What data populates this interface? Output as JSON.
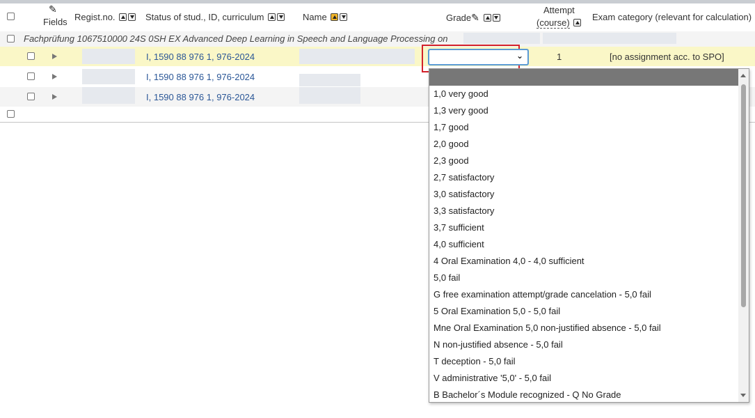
{
  "header": {
    "fields_label": "Fields",
    "regno_label": "Regist.no.",
    "status_label": "Status of stud., ID, curriculum",
    "name_label": "Name",
    "grade_label": "Grade",
    "attempt_label_line1": "Attempt",
    "attempt_label_line2": "(course)",
    "examcat_label": "Exam category (relevant for calculation)"
  },
  "group": {
    "title": "Fachprüfung 1067510000 24S 0SH EX Advanced Deep Learning in Speech and Language Processing on"
  },
  "rows": [
    {
      "status": "I, 1590 88 976 1, 976-2024",
      "attempt": "1",
      "exam_category": "[no assignment acc. to SPO]"
    },
    {
      "status": "I, 1590 88 976 1, 976-2024"
    },
    {
      "status": "I, 1590 88 976 1, 976-2024"
    }
  ],
  "grade_options": [
    "1,0 very good",
    "1,3 very good",
    "1,7 good",
    "2,0 good",
    "2,3 good",
    "2,7 satisfactory",
    "3,0 satisfactory",
    "3,3 satisfactory",
    "3,7 sufficient",
    "4,0 sufficient",
    "4 Oral Examination 4,0 - 4,0 sufficient",
    "5,0 fail",
    "G free examination attempt/grade cancelation - 5,0 fail",
    "5 Oral Examination 5,0 - 5,0 fail",
    "Mne Oral Examination 5,0 non-justified absence - 5,0 fail",
    "N non-justified absence - 5,0 fail",
    "T deception - 5,0 fail",
    "V administrative '5,0' - 5,0 fail",
    "B Bachelor´s Module recognized - Q No Grade"
  ],
  "colors": {
    "link": "#2b5797",
    "selected_row": "#faf7c7",
    "highlight_border": "#d3202a",
    "sort_active": "#f0b429"
  }
}
